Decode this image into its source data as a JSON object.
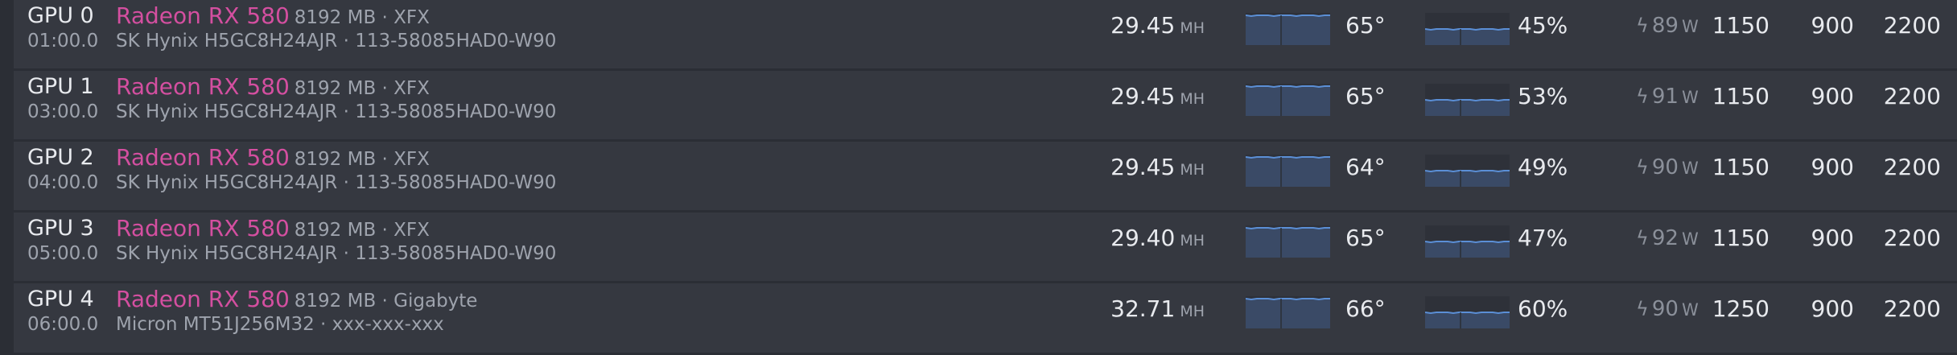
{
  "rows": [
    {
      "id": "GPU 0",
      "bus": "01:00.0",
      "model": "Radeon RX 580",
      "info": "8192 MB · XFX",
      "mem": "SK Hynix H5GC8H24AJR · 113-58085HAD0-W90",
      "hashrate": "29.45",
      "unit": "MH",
      "temp": "65°",
      "fan": "45%",
      "power": "89",
      "power_unit": "W",
      "core": "1150",
      "memclk": "900",
      "volt": "2200"
    },
    {
      "id": "GPU 1",
      "bus": "03:00.0",
      "model": "Radeon RX 580",
      "info": "8192 MB · XFX",
      "mem": "SK Hynix H5GC8H24AJR · 113-58085HAD0-W90",
      "hashrate": "29.45",
      "unit": "MH",
      "temp": "65°",
      "fan": "53%",
      "power": "91",
      "power_unit": "W",
      "core": "1150",
      "memclk": "900",
      "volt": "2200"
    },
    {
      "id": "GPU 2",
      "bus": "04:00.0",
      "model": "Radeon RX 580",
      "info": "8192 MB · XFX",
      "mem": "SK Hynix H5GC8H24AJR · 113-58085HAD0-W90",
      "hashrate": "29.45",
      "unit": "MH",
      "temp": "64°",
      "fan": "49%",
      "power": "90",
      "power_unit": "W",
      "core": "1150",
      "memclk": "900",
      "volt": "2200"
    },
    {
      "id": "GPU 3",
      "bus": "05:00.0",
      "model": "Radeon RX 580",
      "info": "8192 MB · XFX",
      "mem": "SK Hynix H5GC8H24AJR · 113-58085HAD0-W90",
      "hashrate": "29.40",
      "unit": "MH",
      "temp": "65°",
      "fan": "47%",
      "power": "92",
      "power_unit": "W",
      "core": "1150",
      "memclk": "900",
      "volt": "2200"
    },
    {
      "id": "GPU 4",
      "bus": "06:00.0",
      "model": "Radeon RX 580",
      "info": "8192 MB · Gigabyte",
      "mem": "Micron MT51J256M32 · xxx-xxx-xxx",
      "hashrate": "32.71",
      "unit": "MH",
      "temp": "66°",
      "fan": "60%",
      "power": "90",
      "power_unit": "W",
      "core": "1250",
      "memclk": "900",
      "volt": "2200"
    }
  ],
  "icons": {
    "power": "lightning-bolt-icon"
  },
  "colors": {
    "model": "#d44fa0",
    "spark_line": "#5b8fd6",
    "spark_fill": "#3a4a66"
  }
}
